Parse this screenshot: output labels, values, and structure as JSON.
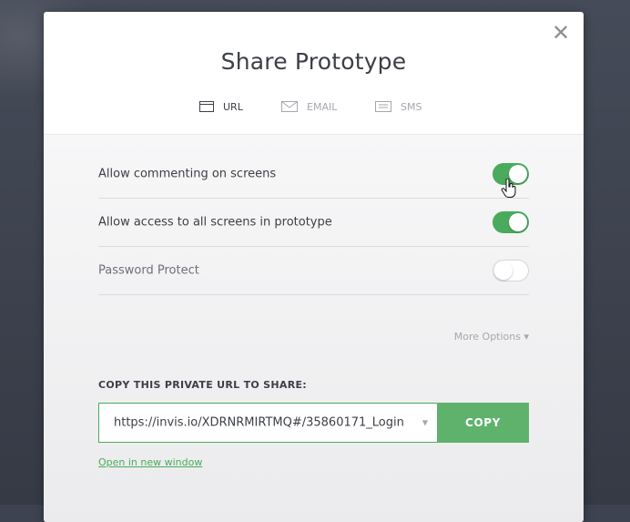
{
  "modal": {
    "title": "Share Prototype",
    "close_glyph": "✕"
  },
  "tabs": [
    {
      "label": "URL",
      "icon": "browser-window-icon",
      "active": true
    },
    {
      "label": "EMAIL",
      "icon": "envelope-icon",
      "active": false
    },
    {
      "label": "SMS",
      "icon": "chat-bubble-icon",
      "active": false
    }
  ],
  "settings": [
    {
      "label": "Allow commenting on screens",
      "enabled": true
    },
    {
      "label": "Allow access to all screens in prototype",
      "enabled": true
    },
    {
      "label": "Password Protect",
      "enabled": false
    }
  ],
  "more_options": {
    "label": "More Options ▾"
  },
  "share": {
    "section_label": "COPY THIS PRIVATE URL TO SHARE:",
    "url": "https://invis.io/XDRNRMIRTMQ#/35860171_Login",
    "copy_label": "COPY",
    "open_link": "Open in new window"
  },
  "colors": {
    "accent": "#4aab5c",
    "copy_button": "#5fb26c",
    "backdrop": "#3d4350"
  }
}
